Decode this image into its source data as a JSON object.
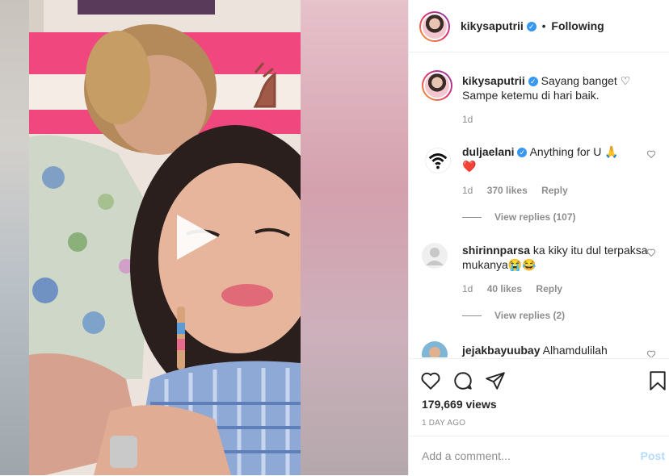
{
  "header": {
    "username": "kikysaputrii",
    "verified_mark": "✓",
    "separator": "•",
    "follow_status": "Following"
  },
  "caption": {
    "username": "kikysaputrii",
    "line1": "Sayang banget ♡",
    "line2": "Sampe ketemu di hari baik.",
    "time": "1d"
  },
  "comments": [
    {
      "username": "duljaelani",
      "verified": true,
      "text": "Anything for U 🙏",
      "text2": "❤️",
      "time": "1d",
      "likes": "370 likes",
      "reply": "Reply",
      "view_replies": "View replies (107)"
    },
    {
      "username": "shirinnparsa",
      "verified": false,
      "text": "ka kiky itu dul terpaksa mukanya😭😂",
      "time": "1d",
      "likes": "40 likes",
      "reply": "Reply",
      "view_replies": "View replies (2)"
    },
    {
      "username": "jejakbayuubay",
      "verified": false,
      "text": "Alhamdulilah"
    }
  ],
  "stats": {
    "views": "179,669 views",
    "time_ago": "1 DAY AGO"
  },
  "comment_box": {
    "placeholder": "Add a comment...",
    "post_label": "Post"
  },
  "icons": {
    "play": "play-icon",
    "like": "heart-icon",
    "comment": "comment-icon",
    "share": "share-icon",
    "save": "bookmark-icon"
  },
  "colors": {
    "verified_badge": "#3897f0",
    "post_disabled": "#b3dbff",
    "meta_gray": "#8e8e8e"
  }
}
